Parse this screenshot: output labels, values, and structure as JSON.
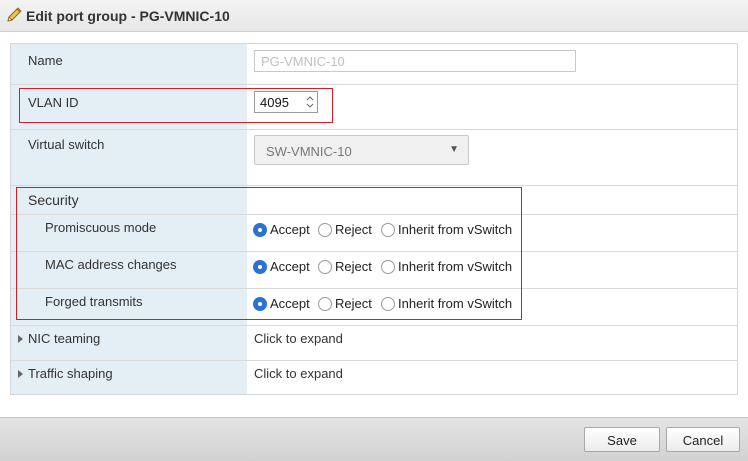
{
  "dialog": {
    "title": "Edit port group - PG-VMNIC-10",
    "title_icon": "pencil-icon"
  },
  "form": {
    "name": {
      "label": "Name",
      "placeholder": "PG-VMNIC-10"
    },
    "vlan": {
      "label": "VLAN ID",
      "value": "4095"
    },
    "vswitch": {
      "label": "Virtual switch",
      "value": "SW-VMNIC-10"
    },
    "security": {
      "label": "Security",
      "options": [
        "Accept",
        "Reject",
        "Inherit from vSwitch"
      ],
      "rows": [
        {
          "label": "Promiscuous mode",
          "selected": "Accept"
        },
        {
          "label": "MAC address changes",
          "selected": "Accept"
        },
        {
          "label": "Forged transmits",
          "selected": "Accept"
        }
      ]
    },
    "nic_teaming": {
      "label": "NIC teaming",
      "value": "Click to expand"
    },
    "traffic_shaping": {
      "label": "Traffic shaping",
      "value": "Click to expand"
    }
  },
  "footer": {
    "save_label": "Save",
    "cancel_label": "Cancel"
  },
  "colors": {
    "label_bg": "#e3eef5",
    "highlight": "#c8232c",
    "radio_on": "#2a73d4"
  }
}
